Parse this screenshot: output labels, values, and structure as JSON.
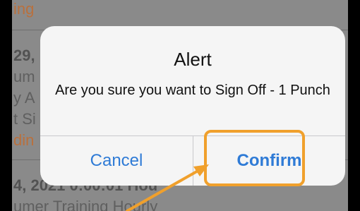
{
  "background": {
    "lines": [
      {
        "text": "ing",
        "style": "orange"
      },
      {
        "text": "29,",
        "style": "bold"
      },
      {
        "text": "um",
        "style": "plain"
      },
      {
        "text": "y A",
        "style": "plain"
      },
      {
        "text": "t Si",
        "style": "plain"
      },
      {
        "text": "din",
        "style": "orange"
      },
      {
        "text": "4, 2021 0:00:01 Hou",
        "style": "bold"
      },
      {
        "text": "umer Training Hourly",
        "style": "plain"
      }
    ]
  },
  "alert": {
    "title": "Alert",
    "message": "Are you sure you want to Sign Off - 1 Punch",
    "cancel_label": "Cancel",
    "confirm_label": "Confirm"
  },
  "colors": {
    "accent": "#2f7bd6",
    "highlight": "#f0a02c",
    "dialog_bg": "#f5f5f5"
  }
}
